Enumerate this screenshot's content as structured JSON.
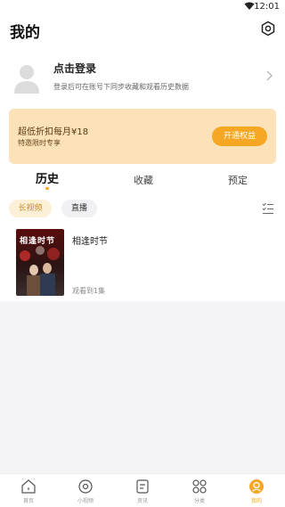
{
  "status_bar": {
    "time": "12:01"
  },
  "header": {
    "title": "我的"
  },
  "login": {
    "title": "点击登录",
    "subtitle": "登录后可在账号下同步收藏和观看历史数据"
  },
  "vip": {
    "title": "超低折扣每月¥18",
    "subtitle": "特邀限时专享",
    "button": "开通权益"
  },
  "tabs": [
    {
      "label": "历史",
      "active": true
    },
    {
      "label": "收藏",
      "active": false
    },
    {
      "label": "预定",
      "active": false
    }
  ],
  "chips": [
    {
      "label": "长视频",
      "active": true
    },
    {
      "label": "直播",
      "active": false
    }
  ],
  "history": [
    {
      "title": "相逢时节",
      "progress": "观看到1集",
      "poster_title": "相逢时节"
    }
  ],
  "bottom_nav": [
    {
      "label": "首页",
      "icon": "home-icon",
      "active": false
    },
    {
      "label": "小视频",
      "icon": "play-circle-icon",
      "active": false
    },
    {
      "label": "资讯",
      "icon": "news-icon",
      "active": false
    },
    {
      "label": "分类",
      "icon": "grid-icon",
      "active": false
    },
    {
      "label": "我的",
      "icon": "profile-icon",
      "active": true
    }
  ],
  "colors": {
    "accent": "#f5a623",
    "banner": "#fbe2b8",
    "background": "#f4f4f6"
  }
}
